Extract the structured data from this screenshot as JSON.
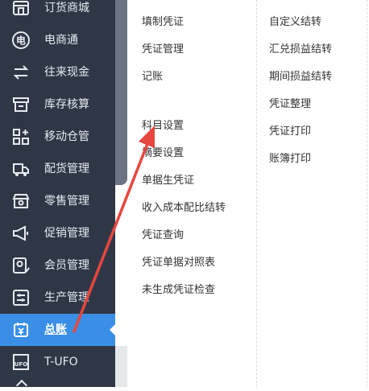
{
  "sidebar": {
    "items": [
      {
        "label": "订货商城",
        "icon": "shop-icon"
      },
      {
        "label": "电商通",
        "icon": "ecommerce-icon"
      },
      {
        "label": "往来现金",
        "icon": "exchange-icon"
      },
      {
        "label": "库存核算",
        "icon": "inventory-icon"
      },
      {
        "label": "移动仓管",
        "icon": "mobile-warehouse-icon"
      },
      {
        "label": "配货管理",
        "icon": "delivery-truck-icon"
      },
      {
        "label": "零售管理",
        "icon": "retail-store-icon"
      },
      {
        "label": "促销管理",
        "icon": "megaphone-icon"
      },
      {
        "label": "会员管理",
        "icon": "member-icon"
      },
      {
        "label": "生产管理",
        "icon": "production-icon"
      },
      {
        "label": "总账",
        "icon": "ledger-icon",
        "active": true
      },
      {
        "label": "T-UFO",
        "icon": "ufo-icon"
      }
    ]
  },
  "menu": {
    "col1_top": [
      "填制凭证",
      "凭证管理",
      "记账"
    ],
    "col1_bottom": [
      "科目设置",
      "摘要设置",
      "单据生凭证",
      "收入成本配比结转",
      "凭证查询",
      "凭证单据对照表",
      "未生成凭证检查"
    ],
    "col2": [
      "自定义结转",
      "汇兑损益结转",
      "期间损益结转",
      "凭证整理",
      "凭证打印",
      "账簿打印"
    ]
  },
  "colors": {
    "sidebar_bg": "#2f3747",
    "active_bg": "#3a8ee6",
    "annotation_arrow": "#e8463e"
  }
}
